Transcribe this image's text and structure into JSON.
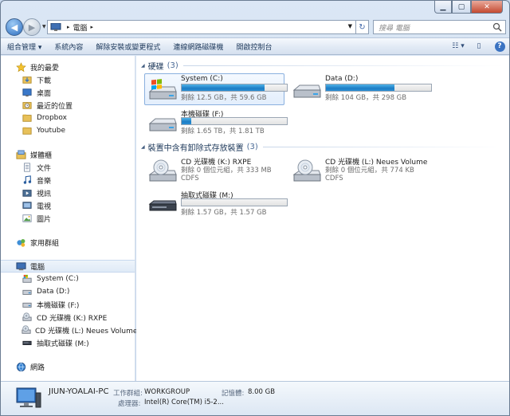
{
  "address": {
    "location": "電腦",
    "search_placeholder": "搜尋 電腦"
  },
  "toolbar": {
    "items": [
      "組合管理 ▾",
      "系統內容",
      "解除安裝或變更程式",
      "連線網路磁碟機",
      "開啟控制台"
    ]
  },
  "nav": {
    "favorites_label": "我的最愛",
    "favorites": [
      "下載",
      "桌面",
      "最近的位置",
      "Dropbox",
      "Youtube"
    ],
    "libraries_label": "媒體櫃",
    "libraries": [
      "文件",
      "音樂",
      "視訊",
      "電視",
      "圖片"
    ],
    "homegroup_label": "家用群組",
    "computer_label": "電腦",
    "computer_items": [
      "System (C:)",
      "Data (D:)",
      "本機磁碟 (F:)",
      "CD 光碟機 (K:) RXPE",
      "CD 光碟機 (L:) Neues Volume",
      "抽取式磁碟 (M:)"
    ],
    "network_label": "網路"
  },
  "content": {
    "hdd_group": {
      "title": "硬碟",
      "count": "(3)"
    },
    "hdd": [
      {
        "name": "System (C:)",
        "free": "剩餘 12.5 GB，共 59.6 GB",
        "used_fraction": 0.79
      },
      {
        "name": "Data (D:)",
        "free": "剩餘 104 GB，共 298 GB",
        "used_fraction": 0.65
      },
      {
        "name": "本機磁碟 (F:)",
        "free": "剩餘 1.65 TB，共 1.81 TB",
        "used_fraction": 0.09
      }
    ],
    "removable_group": {
      "title": "裝置中含有卸除式存放裝置",
      "count": "(3)"
    },
    "removable": [
      {
        "name": "CD 光碟機 (K:) RXPE",
        "line2": "剩餘 0 個位元組，共 333 MB",
        "line3": "CDFS"
      },
      {
        "name": "CD 光碟機 (L:) Neues Volume",
        "line2": "剩餘 0 個位元組，共 774 KB",
        "line3": "CDFS"
      },
      {
        "name": "抽取式磁碟 (M:)",
        "free": "剩餘 1.57 GB，共 1.57 GB",
        "used_fraction": 0.0
      }
    ]
  },
  "details": {
    "computer_name": "JIUN-YOALAI-PC",
    "workgroup_label": "工作群組:",
    "workgroup": "WORKGROUP",
    "memory_label": "記憶體:",
    "memory": "8.00 GB",
    "processor_label": "處理器:",
    "processor": "Intel(R) Core(TM) i5-2..."
  }
}
